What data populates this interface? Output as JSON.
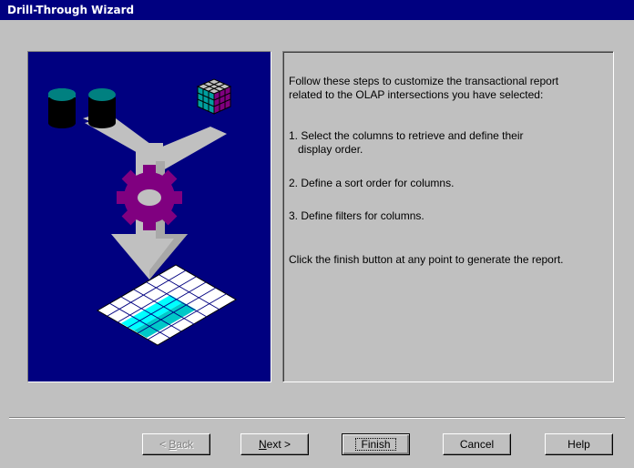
{
  "window": {
    "title": "Drill-Through Wizard"
  },
  "intro": {
    "line1": "Follow these steps to customize the transactional report",
    "line2": "related to the OLAP intersections you have selected:"
  },
  "steps": [
    {
      "line1": "1. Select the columns to retrieve and define their",
      "line2": "display order."
    },
    {
      "line1": "2. Define a sort order for columns."
    },
    {
      "line1": "3. Define filters for columns."
    }
  ],
  "footer_note": "Click the finish button at any point to generate the report.",
  "buttons": {
    "back": {
      "mnemonic": "B",
      "rest": "ack",
      "prefix": "< "
    },
    "next": {
      "mnemonic": "N",
      "rest": "ext >"
    },
    "finish": "Finish",
    "cancel": "Cancel",
    "help": "Help"
  },
  "colors": {
    "title_bar": "#000080",
    "art_background": "#000080",
    "dialog_face": "#c0c0c0",
    "gear": "#800080",
    "cylinders": "#008080",
    "highlight_column": "#00ffff"
  },
  "icons": [
    "database-cylinders-icon",
    "olap-cube-icon",
    "gear-icon",
    "report-grid-icon"
  ]
}
